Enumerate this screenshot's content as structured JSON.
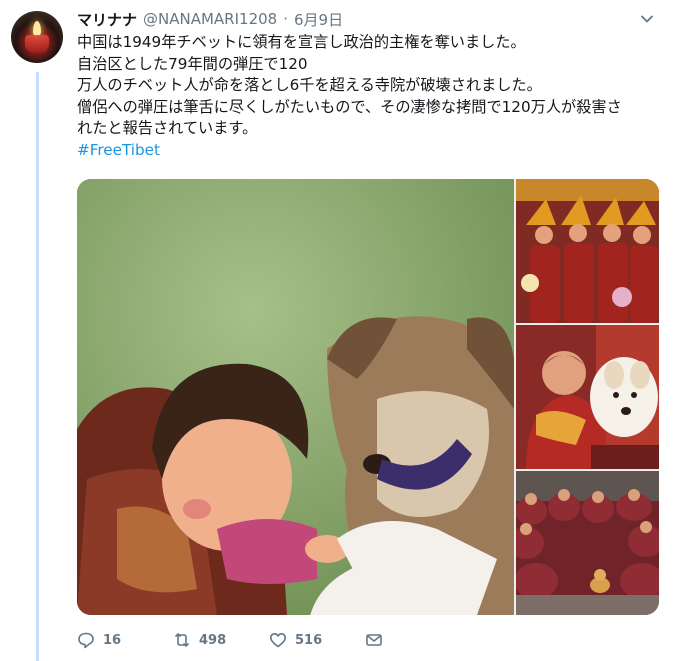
{
  "tweet": {
    "display_name": "マリナナ",
    "handle": "@NANAMARI1208",
    "separator": "·",
    "date": "6月9日",
    "lines": [
      "中国は1949年チベットに領有を宣言し政治的主権を奪いました。",
      "自治区とした79年間の弾圧で120",
      "万人のチベット人が命を落とし6千を超える寺院が破壊されました。",
      "僧侶への弾圧は筆舌に尽くしがたいもので、その凄惨な拷問で120万人が殺害さ",
      "れたと報告されています。"
    ],
    "hashtag": "#FreeTibet"
  },
  "actions": {
    "reply_count": "16",
    "retweet_count": "498",
    "like_count": "516"
  },
  "icons": {
    "more": "chevron-down-icon",
    "reply": "reply-icon",
    "retweet": "retweet-icon",
    "like": "heart-icon",
    "dm": "envelope-icon"
  },
  "colors": {
    "text": "#14171a",
    "secondary": "#657786",
    "link": "#1b95e0",
    "thread_line": "#c4dfff"
  }
}
